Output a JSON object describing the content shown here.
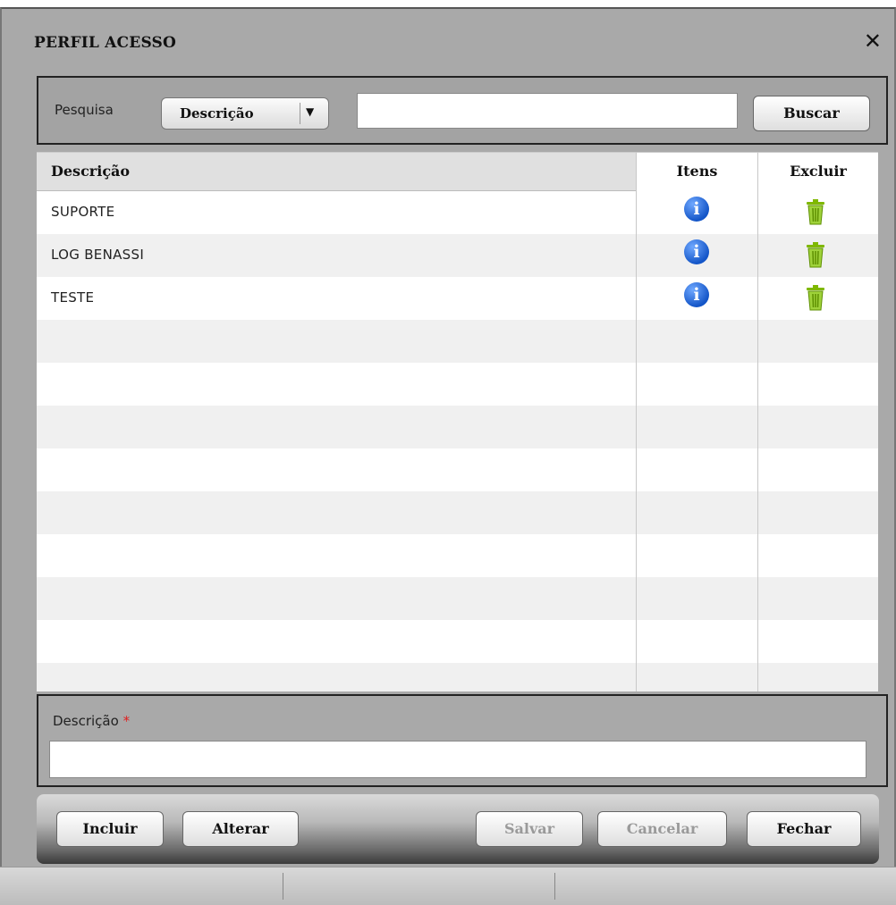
{
  "dialog": {
    "title": "PERFIL ACESSO",
    "close_glyph": "✕"
  },
  "search": {
    "label": "Pesquisa",
    "field_selected": "Descrição",
    "input_value": "",
    "button_label": "Buscar"
  },
  "grid": {
    "columns": {
      "descricao": "Descrição",
      "itens": "Itens",
      "excluir": "Excluir"
    },
    "rows": [
      {
        "descricao": "SUPORTE"
      },
      {
        "descricao": "LOG BENASSI"
      },
      {
        "descricao": "TESTE"
      }
    ],
    "icons": {
      "info": "info-icon",
      "delete": "trash-icon"
    }
  },
  "form": {
    "descricao_label": "Descrição",
    "required_mark": "*",
    "descricao_value": ""
  },
  "toolbar": {
    "incluir": "Incluir",
    "alterar": "Alterar",
    "salvar": "Salvar",
    "cancelar": "Cancelar",
    "fechar": "Fechar"
  },
  "colors": {
    "accent_blue": "#1456c8",
    "trash_green": "#8cc63f",
    "required_red": "#e02020"
  }
}
